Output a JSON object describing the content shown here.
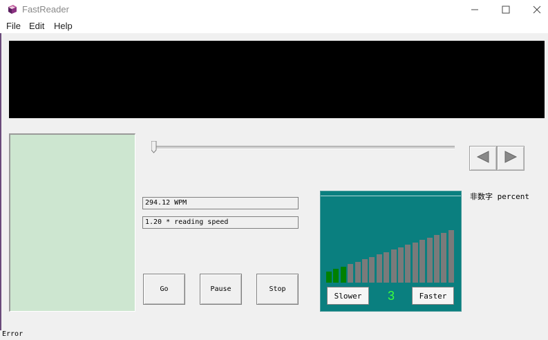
{
  "window": {
    "title": "FastReader"
  },
  "menu": [
    "File",
    "Edit",
    "Help"
  ],
  "fields": {
    "wpm": "294.12 WPM",
    "speed": "1.20 * reading speed"
  },
  "buttons": {
    "go": "Go",
    "pause": "Pause",
    "stop": "Stop"
  },
  "speed_panel": {
    "slower": "Slower",
    "faster": "Faster",
    "level": "3",
    "total_bars": 18,
    "active_bars": 3,
    "active_color": "#008000",
    "inactive_color": "#7a7a7a"
  },
  "percent_label": "非数字 percent",
  "status": "Error",
  "icons": [
    "app-book-icon",
    "minimize-icon",
    "maximize-icon",
    "close-icon",
    "arrow-left-icon",
    "arrow-right-icon"
  ]
}
